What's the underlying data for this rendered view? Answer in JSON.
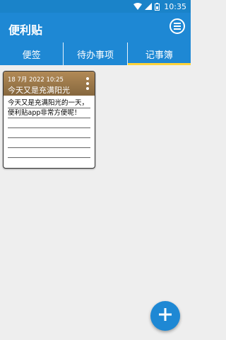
{
  "status_bar": {
    "time": "10:35"
  },
  "app_bar": {
    "title": "便利贴"
  },
  "tabs": [
    {
      "label": "便签",
      "active": false
    },
    {
      "label": "待办事项",
      "active": false
    },
    {
      "label": "记事簿",
      "active": true
    }
  ],
  "notes": [
    {
      "date": "18 7月 2022 10:25",
      "title": "今天又是充满阳光",
      "body": "今天又是充满阳光的一天，便利贴app非常方便呢！"
    }
  ],
  "colors": {
    "primary": "#1e88d4",
    "tab_indicator": "#ffd33a",
    "note_header": "#9c7a4a",
    "background": "#eeeeee"
  },
  "icons": {
    "wifi": "wifi-icon",
    "signal": "signal-icon",
    "battery": "battery-icon",
    "menu": "menu-icon",
    "more": "more-vertical-icon",
    "add": "plus-icon"
  }
}
